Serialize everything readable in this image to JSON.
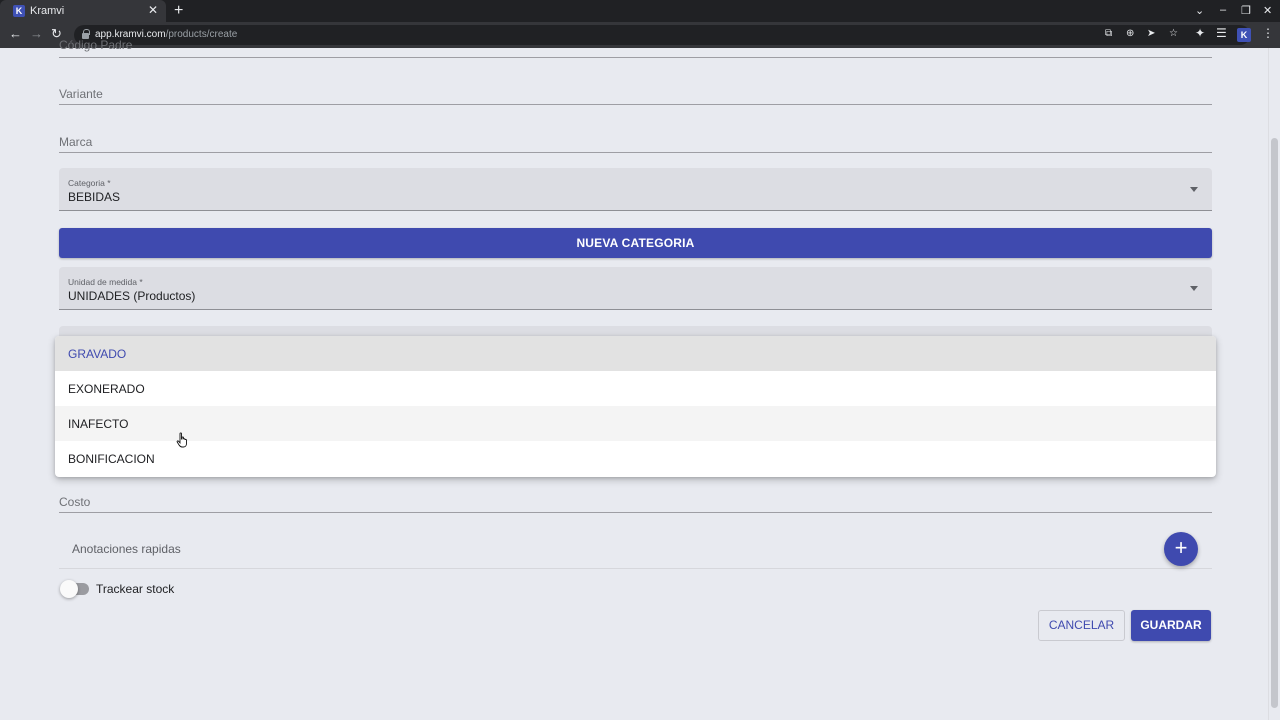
{
  "browser": {
    "tab_title": "Kramvi",
    "tab_favicon": "K",
    "new_tab": "+",
    "url_domain": "app.kramvi.com",
    "url_path": "/products/create",
    "extension_badge": "K"
  },
  "form": {
    "partial_field": "Código Padre",
    "variante_placeholder": "Variante",
    "marca_placeholder": "Marca",
    "categoria": {
      "label": "Categoria *",
      "value": "BEBIDAS"
    },
    "nueva_categoria_label": "NUEVA CATEGORIA",
    "unidad": {
      "label": "Unidad de medida *",
      "value": "UNIDADES (Productos)"
    },
    "costo_placeholder": "Costo",
    "anotaciones_label": "Anotaciones rapidas",
    "add_icon": "+",
    "trackear_label": "Trackear stock",
    "trackear_on": false,
    "cancel_label": "CANCELAR",
    "save_label": "GUARDAR"
  },
  "dropdown": {
    "options": [
      {
        "label": "GRAVADO",
        "selected": true
      },
      {
        "label": "EXONERADO",
        "selected": false
      },
      {
        "label": "INAFECTO",
        "selected": false,
        "hovered": true
      },
      {
        "label": "BONIFICACION",
        "selected": false
      }
    ]
  },
  "colors": {
    "primary": "#3f4aaf",
    "page_bg": "#e8eaf0"
  }
}
